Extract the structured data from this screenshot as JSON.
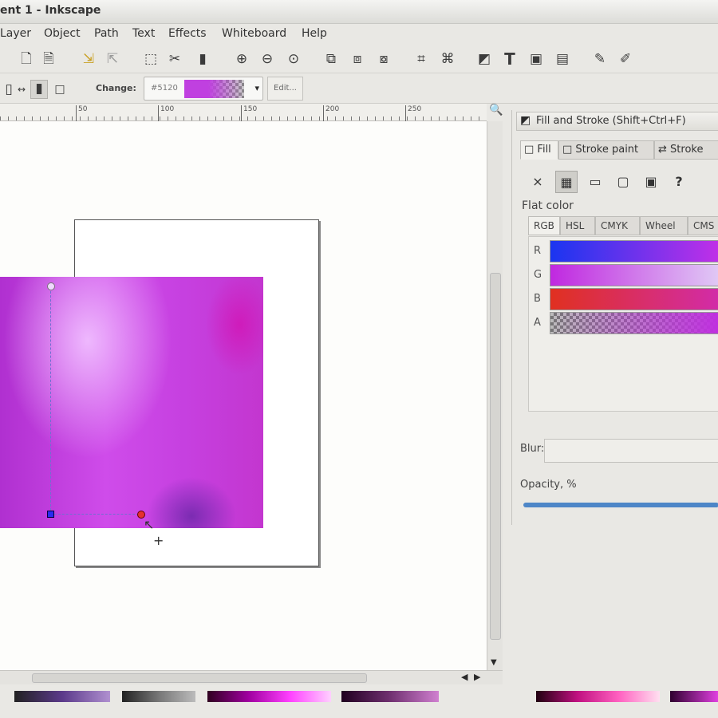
{
  "window": {
    "title": "ent 1 - Inkscape"
  },
  "menu": [
    "Layer",
    "Object",
    "Path",
    "Text",
    "Effects",
    "Whiteboard",
    "Help"
  ],
  "toolbar_icons": [
    "new-document-icon",
    "open-icon",
    "import-icon",
    "export-icon",
    "print-icon",
    "zoom-in-icon",
    "zoom-out-icon",
    "zoom-fit-icon",
    "duplicate-icon",
    "clone-icon",
    "group-icon",
    "align-icon",
    "distribute-icon",
    "fill-stroke-icon",
    "text-tool-icon",
    "xml-editor-icon",
    "layers-icon",
    "preferences-icon",
    "pen-icon"
  ],
  "gradient_toolbar": {
    "change_label": "Change:",
    "stop_id": "#5120",
    "edit_label": "Edit..."
  },
  "ruler": {
    "labels": [
      "50",
      "100",
      "150",
      "200",
      "250"
    ]
  },
  "panel": {
    "title": "Fill and Stroke (Shift+Ctrl+F)",
    "tabs": [
      "Fill",
      "Stroke paint",
      "Stroke"
    ],
    "mode_buttons": [
      "no-paint-icon",
      "flat-color-icon",
      "linear-gradient-icon",
      "radial-gradient-icon",
      "pattern-icon",
      "unset-icon"
    ],
    "mode_symbols": {
      "none": "×",
      "unset": "?"
    },
    "flat_color_label": "Flat color",
    "color_tabs": [
      "RGB",
      "HSL",
      "CMYK",
      "Wheel",
      "CMS"
    ],
    "channels": [
      {
        "label": "R",
        "gradient": "linear-gradient(90deg,#1a35f0,#c030e8)"
      },
      {
        "label": "G",
        "gradient": "linear-gradient(90deg,#c028e0,#e0c8f5)"
      },
      {
        "label": "B",
        "gradient": "linear-gradient(90deg,#e03020,#d22ca8)"
      },
      {
        "label": "A",
        "gradient": "linear-gradient(90deg,rgba(192,48,224,0),#c030e0)"
      }
    ],
    "blur_label": "Blur:",
    "opacity_label": "Opacity, %"
  },
  "palette": [
    "linear-gradient(90deg,#222,#5b3a8a,#b090d0)",
    "linear-gradient(90deg,#222,#777,#bbb)",
    "linear-gradient(90deg,#300020,#a000a0,#ff40ff,#ffd0ff)",
    "linear-gradient(90deg,#200020,#703070,#d080d0)",
    "linear-gradient(90deg,#200010,#c01080,#ff60c0,#ffe0f0)",
    "linear-gradient(90deg,#300030,#e040e0)"
  ]
}
